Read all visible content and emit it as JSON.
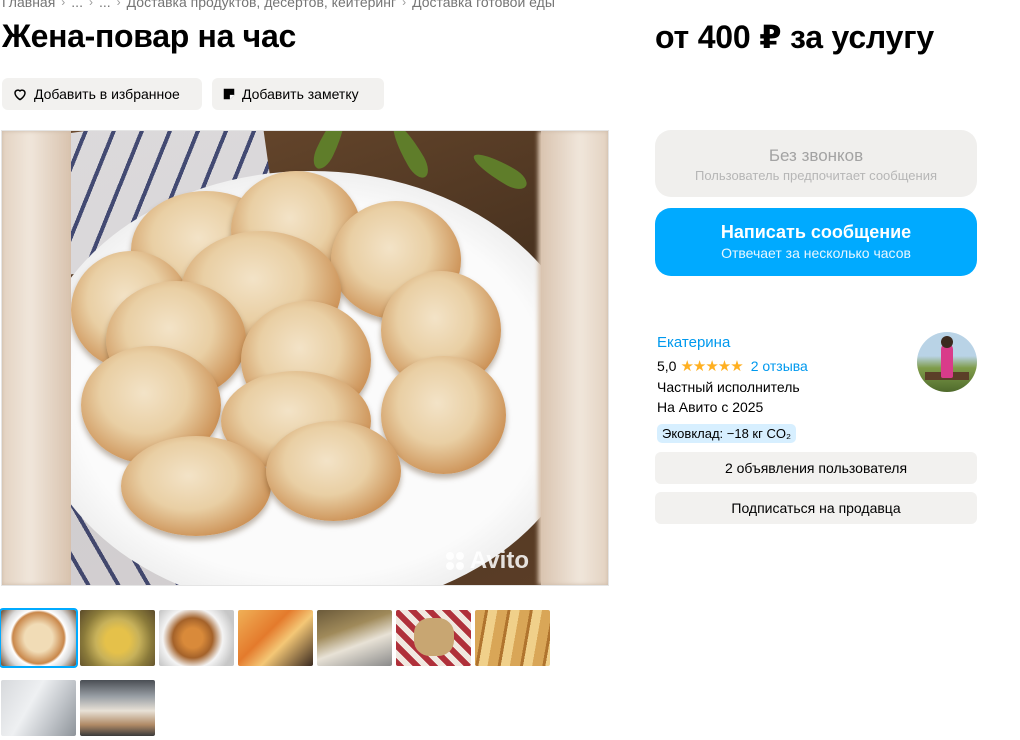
{
  "breadcrumbs": {
    "items": [
      "Главная",
      "...",
      "...",
      "Доставка продуктов, десертов, кейтеринг",
      "Доставка готовой еды"
    ]
  },
  "listing": {
    "title": "Жена-повар на час",
    "price": "от 400 ₽ за услугу"
  },
  "actions": {
    "favorite_label": "Добавить в избранное",
    "note_label": "Добавить заметку"
  },
  "gallery": {
    "watermark": "Avito",
    "active_index": 0,
    "thumb_count": 9
  },
  "contact": {
    "no_calls_title": "Без звонков",
    "no_calls_subtitle": "Пользователь предпочитает сообщения",
    "write_title": "Написать сообщение",
    "write_subtitle": "Отвечает за несколько часов"
  },
  "seller": {
    "name": "Екатерина",
    "rating": "5,0",
    "stars": "★★★★★",
    "reviews": "2 отзыва",
    "type": "Частный исполнитель",
    "since": "На Авито с 2025",
    "eco": "Эковклад: −18 кг CO₂",
    "ads_button": "2 объявления пользователя",
    "subscribe_button": "Подписаться на продавца"
  },
  "colors": {
    "accent": "#00aaff",
    "link": "#0099ee",
    "star": "#ffb021",
    "button_gray": "#f2f1ef"
  }
}
